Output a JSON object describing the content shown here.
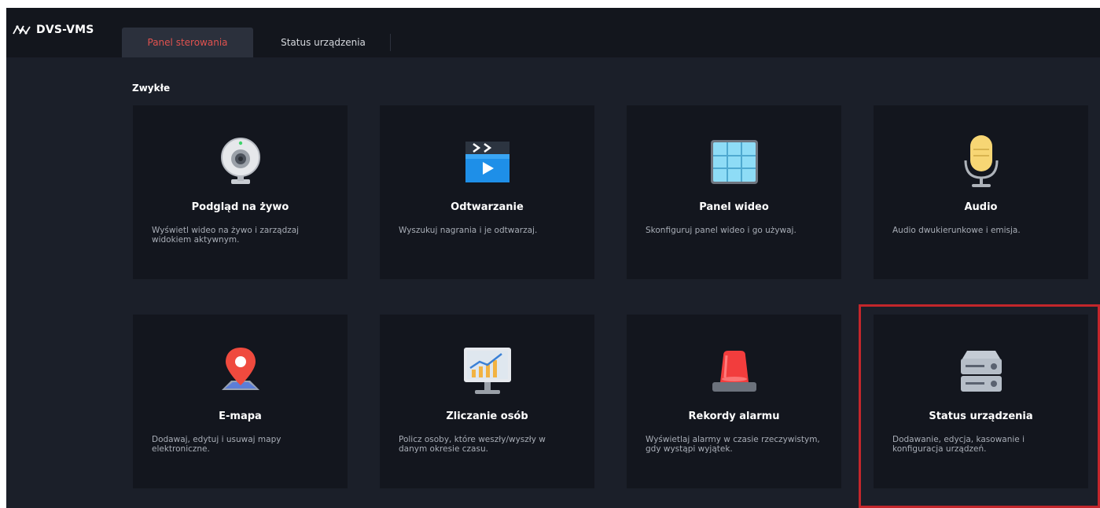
{
  "app": {
    "title": "DVS-VMS"
  },
  "tabs": [
    {
      "label": "Panel sterowania",
      "active": true
    },
    {
      "label": "Status urządzenia",
      "active": false
    }
  ],
  "section": {
    "title": "Zwykłe"
  },
  "cards": [
    {
      "title": "Podgląd na żywo",
      "desc": "Wyświetl wideo na żywo i zarządzaj widokiem aktywnym.",
      "icon": "webcam-icon"
    },
    {
      "title": "Odtwarzanie",
      "desc": "Wyszukuj nagrania i je odtwarzaj.",
      "icon": "playback-clapper-icon"
    },
    {
      "title": "Panel wideo",
      "desc": "Skonfiguruj panel wideo i go używaj.",
      "icon": "video-wall-icon"
    },
    {
      "title": "Audio",
      "desc": "Audio dwukierunkowe i emisja.",
      "icon": "microphone-icon"
    },
    {
      "title": "E-mapa",
      "desc": "Dodawaj, edytuj i usuwaj mapy elektroniczne.",
      "icon": "map-pin-icon"
    },
    {
      "title": "Zliczanie osób",
      "desc": "Policz osoby, które weszły/wyszły w danym okresie czasu.",
      "icon": "monitor-chart-icon"
    },
    {
      "title": "Rekordy alarmu",
      "desc": "Wyświetlaj alarmy w czasie rzeczywistym, gdy wystąpi wyjątek.",
      "icon": "alarm-siren-icon"
    },
    {
      "title": "Status urządzenia",
      "desc": "Dodawanie, edycja, kasowanie i konfiguracja urządzeń.",
      "icon": "device-server-icon"
    }
  ],
  "colors": {
    "accent": "#e0524f",
    "background": "#1b1f29",
    "card": "#13161e",
    "highlight": "#c3262b"
  }
}
